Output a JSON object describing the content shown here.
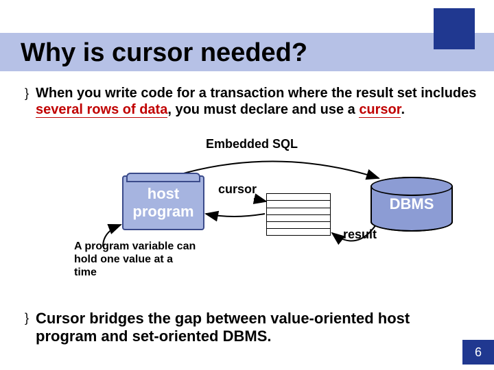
{
  "title": "Why is cursor needed?",
  "bullet1": {
    "pre": "When you write code for a transaction where the result set includes ",
    "hl1": "several rows of data",
    "mid": ", you must declare and use a ",
    "hl2": "cursor",
    "post": "."
  },
  "diagram": {
    "embedded_label": "Embedded SQL",
    "host_line1": "host",
    "host_line2": "program",
    "cursor_label": "cursor",
    "dbms_label": "DBMS",
    "result_label": "result",
    "note": "A program variable can hold one value at a time"
  },
  "bullet2": "Cursor bridges the gap between value-oriented host program and set-oriented DBMS.",
  "page_number": "6"
}
